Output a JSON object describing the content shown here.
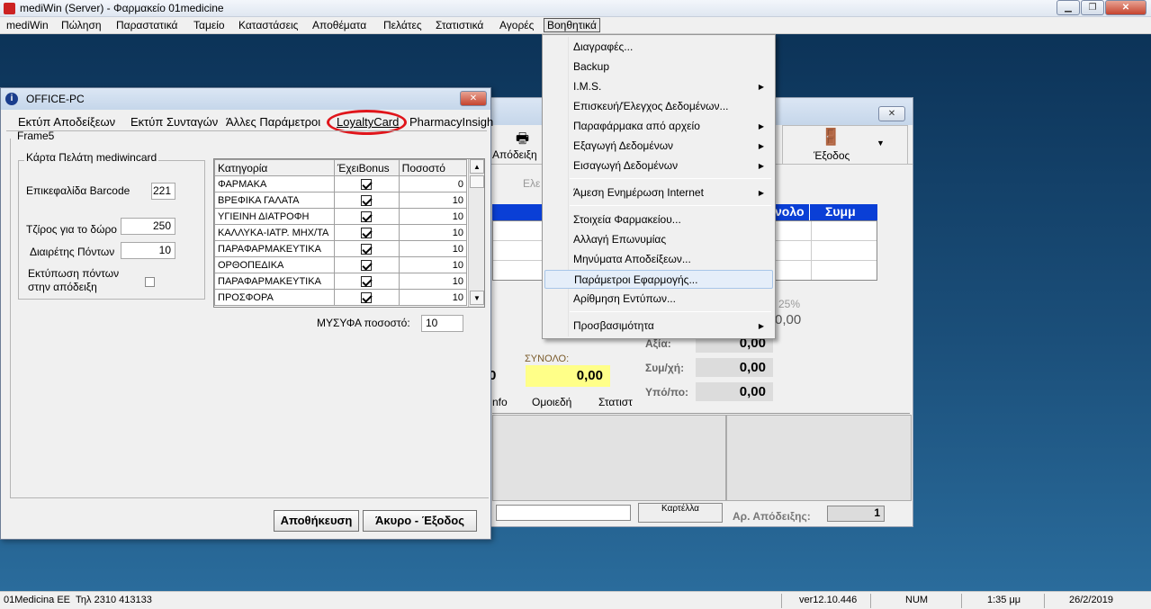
{
  "window": {
    "title": "mediWin (Server) - Φαρμακείο 01medicine"
  },
  "menubar": [
    "mediWin",
    "Πώληση",
    "Παραστατικά",
    "Ταμείο",
    "Καταστάσεις",
    "Αποθέματα",
    "Πελάτες",
    "Στατιστικά",
    "Αγορές",
    "Βοηθητικά"
  ],
  "dropdown": {
    "items": [
      {
        "label": "Διαγραφές...",
        "submenu": false
      },
      {
        "label": "Backup",
        "submenu": false
      },
      {
        "label": "I.M.S.",
        "submenu": true
      },
      {
        "label": "Επισκευή/Έλεγχος Δεδομένων...",
        "submenu": false
      },
      {
        "label": "Παραφάρμακα από αρχείο",
        "submenu": true
      },
      {
        "label": "Εξαγωγή Δεδομένων",
        "submenu": true
      },
      {
        "label": "Εισαγωγή Δεδομένων",
        "submenu": true
      },
      {
        "label": "Άμεση Ενημέρωση Internet",
        "submenu": true
      },
      {
        "label": "Στοιχεία Φαρμακείου...",
        "submenu": false
      },
      {
        "label": "Αλλαγή Επωνυμίας",
        "submenu": false
      },
      {
        "label": "Μηνύματα Αποδείξεων...",
        "submenu": false
      },
      {
        "label": "Παράμετροι Εφαρμογής...",
        "submenu": false,
        "highlighted": true
      },
      {
        "label": "Αρίθμηση Εντύπων...",
        "submenu": false
      },
      {
        "label": "Προσβασιμότητα",
        "submenu": true
      }
    ]
  },
  "dialog": {
    "title": "OFFICE-PC",
    "tabs": [
      "Εκτύπ Αποδείξεων",
      "Εκτύπ Συνταγών",
      "Άλλες Παράμετροι",
      "LoyaltyCard",
      "PharmacyInsigh"
    ],
    "frame_label": "Frame5",
    "group_label": "Κάρτα Πελάτη mediwincard",
    "fields": {
      "barcode_label": "Επικεφαλίδα Barcode",
      "barcode_value": "221",
      "gift_label": "Τζίρος για το δώρο",
      "gift_value": "250",
      "divisor_label": "Διαιρέτης Πόντων",
      "divisor_value": "10",
      "print_label_1": "Εκτύπωση πόντων",
      "print_label_2": "στην απόδειξη"
    },
    "grid": {
      "headers": [
        "Κατηγορία",
        "ΈχειBonus",
        "Ποσοστό"
      ],
      "rows": [
        {
          "cat": "ΦΑΡΜΑΚΑ",
          "bonus": true,
          "pct": "0"
        },
        {
          "cat": "ΒΡΕΦΙΚΑ ΓΑΛΑΤΑ",
          "bonus": true,
          "pct": "10"
        },
        {
          "cat": "ΥΓΙΕΙΝΗ ΔΙΑΤΡΟΦΗ",
          "bonus": true,
          "pct": "10"
        },
        {
          "cat": "ΚΑΛΛΥΚΑ-ΙΑΤΡ. ΜΗΧ/ΤΑ",
          "bonus": true,
          "pct": "10"
        },
        {
          "cat": "ΠΑΡΑΦΑΡΜΑΚΕΥΤΙΚΑ",
          "bonus": true,
          "pct": "10"
        },
        {
          "cat": "ΟΡΘΟΠΕΔΙΚΑ",
          "bonus": true,
          "pct": "10"
        },
        {
          "cat": "ΠΑΡΑΦΑΡΜΑΚΕΥΤΙΚΑ",
          "bonus": true,
          "pct": "10"
        },
        {
          "cat": "ΠΡΟΣΦΟΡΑ",
          "bonus": true,
          "pct": "10"
        }
      ]
    },
    "mysfa_label": "ΜΥΣΥΦΑ ποσοστό:",
    "mysfa_value": "10",
    "save_label": "Αποθήκευση",
    "cancel_label": "Άκυρο - Έξοδος"
  },
  "bgform": {
    "toolbar": {
      "receipt": "Απόδειξη",
      "exit": "Έξοδος"
    },
    "faded_label": "Ελε",
    "header_cols": [
      "νολο",
      "Συμμ"
    ],
    "pct25": "25%",
    "val_top": "0,00",
    "sum_label": "ΣΥΝΟΛΟ:",
    "sum_value": "0,00",
    "left_zero": "0",
    "axia_label": "Αξία:",
    "axia_value": "0,00",
    "symxi_label": "Συμ/χή:",
    "symxi_value": "0,00",
    "ypo_label": "Υπό/πο:",
    "ypo_value": "0,00",
    "tabs": [
      "nfo",
      "Ομοιεδή",
      "Στατιστ"
    ],
    "kartella_label": "Καρτέλλα",
    "ar_label": "Αρ. Απόδειξης:",
    "ar_value": "1"
  },
  "status": {
    "company": "01Medicina ΕΕ",
    "phone": "Τηλ 2310 413133",
    "version": "ver12.10.446",
    "num": "NUM",
    "time": "1:35 μμ",
    "date": "26/2/2019"
  },
  "colors": {
    "highlight_circle": "#e0151b",
    "sum_bg": "#ffff88",
    "header_blue": "#0a3fd6"
  }
}
